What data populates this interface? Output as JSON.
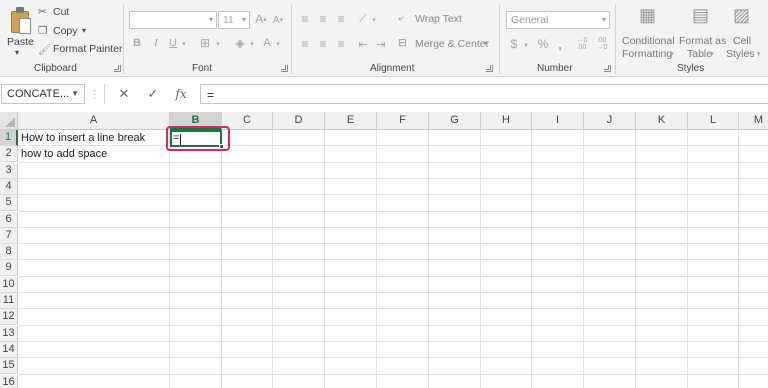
{
  "clipboard": {
    "paste_label": "Paste",
    "cut_label": "Cut",
    "copy_label": "Copy",
    "format_painter_label": "Format Painter",
    "group_label": "Clipboard"
  },
  "font": {
    "font_name_value": "",
    "font_size_value": "11",
    "group_label": "Font"
  },
  "alignment": {
    "wrap_text_label": "Wrap Text",
    "merge_center_label": "Merge & Center",
    "group_label": "Alignment"
  },
  "number": {
    "format_value": "General",
    "currency_symbol": "$",
    "percent_symbol": "%",
    "comma_symbol": ",",
    "group_label": "Number"
  },
  "styles": {
    "conditional_line1": "Conditional",
    "conditional_line2": "Formatting",
    "format_table_line1": "Format as",
    "format_table_line2": "Table",
    "cell_styles_line1": "Cell",
    "cell_styles_line2": "Styles",
    "group_label": "Styles"
  },
  "formula_bar": {
    "name_box_value": "CONCATE...",
    "fx_label": "fx",
    "content": "="
  },
  "sheet": {
    "columns": [
      "A",
      "B",
      "C",
      "D",
      "E",
      "F",
      "G",
      "H",
      "I",
      "J",
      "K",
      "L",
      "M"
    ],
    "rows": [
      "1",
      "2",
      "3",
      "4",
      "5",
      "6",
      "7",
      "8",
      "9",
      "10",
      "11",
      "12",
      "13",
      "14",
      "15",
      "16"
    ],
    "active_column": "B",
    "active_row": "1",
    "cells": {
      "A1": "How to insert  a line break",
      "A2": "how to add space",
      "B1": "="
    }
  },
  "colors": {
    "accent": "#217346",
    "highlight": "#e0245e"
  }
}
